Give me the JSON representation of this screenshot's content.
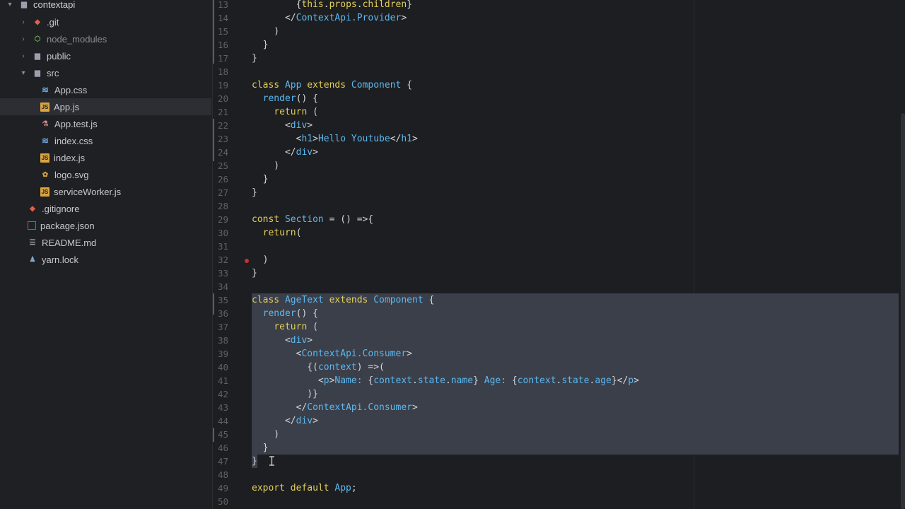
{
  "sidebar": {
    "items": [
      {
        "label": "contextapi",
        "icon": "folder-open-icon",
        "chev": "▾"
      },
      {
        "label": ".git",
        "icon": "git-icon",
        "chev": "›"
      },
      {
        "label": "node_modules",
        "icon": "node-icon",
        "chev": "›"
      },
      {
        "label": "public",
        "icon": "folder-icon",
        "chev": "›"
      },
      {
        "label": "src",
        "icon": "folder-open-icon",
        "chev": "▾"
      },
      {
        "label": "App.css",
        "icon": "css-icon"
      },
      {
        "label": "App.js",
        "icon": "js-icon"
      },
      {
        "label": "App.test.js",
        "icon": "test-icon"
      },
      {
        "label": "index.css",
        "icon": "css-icon"
      },
      {
        "label": "index.js",
        "icon": "js-icon"
      },
      {
        "label": "logo.svg",
        "icon": "svg-icon"
      },
      {
        "label": "serviceWorker.js",
        "icon": "js-icon"
      },
      {
        "label": ".gitignore",
        "icon": "git-icon"
      },
      {
        "label": "package.json",
        "icon": "npm-icon"
      },
      {
        "label": "README.md",
        "icon": "readme-icon"
      },
      {
        "label": "yarn.lock",
        "icon": "yarn-icon"
      }
    ]
  },
  "editor": {
    "lines": [
      {
        "n": "13",
        "segs": [
          [
            "plain",
            "        {"
          ],
          [
            "kw",
            "this"
          ],
          [
            "plain",
            "."
          ],
          [
            "kw",
            "props"
          ],
          [
            "plain",
            "."
          ],
          [
            "kw",
            "children"
          ],
          [
            "plain",
            "}"
          ]
        ]
      },
      {
        "n": "14",
        "segs": [
          [
            "plain",
            "      </"
          ],
          [
            "tagname",
            "ContextApi.Provider"
          ],
          [
            "plain",
            ">"
          ]
        ]
      },
      {
        "n": "15",
        "segs": [
          [
            "plain",
            "    )"
          ]
        ]
      },
      {
        "n": "16",
        "segs": [
          [
            "plain",
            "  }"
          ]
        ]
      },
      {
        "n": "17",
        "segs": [
          [
            "plain",
            "}"
          ]
        ]
      },
      {
        "n": "18",
        "segs": []
      },
      {
        "n": "19",
        "segs": [
          [
            "kw",
            "class "
          ],
          [
            "cls",
            "App "
          ],
          [
            "kw",
            "extends "
          ],
          [
            "cls",
            "Component "
          ],
          [
            "plain",
            "{"
          ]
        ]
      },
      {
        "n": "20",
        "segs": [
          [
            "plain",
            "  "
          ],
          [
            "cls",
            "render"
          ],
          [
            "plain",
            "() {"
          ]
        ]
      },
      {
        "n": "21",
        "segs": [
          [
            "plain",
            "    "
          ],
          [
            "kw",
            "return"
          ],
          [
            "plain",
            " ("
          ]
        ]
      },
      {
        "n": "22",
        "segs": [
          [
            "plain",
            "      <"
          ],
          [
            "tagname",
            "div"
          ],
          [
            "plain",
            ">"
          ]
        ]
      },
      {
        "n": "23",
        "segs": [
          [
            "plain",
            "        <"
          ],
          [
            "tagname",
            "h1"
          ],
          [
            "plain",
            ">"
          ],
          [
            "txt",
            "Hello Youtube"
          ],
          [
            "plain",
            "</"
          ],
          [
            "tagname",
            "h1"
          ],
          [
            "plain",
            ">"
          ]
        ]
      },
      {
        "n": "24",
        "segs": [
          [
            "plain",
            "      </"
          ],
          [
            "tagname",
            "div"
          ],
          [
            "plain",
            ">"
          ]
        ]
      },
      {
        "n": "25",
        "segs": [
          [
            "plain",
            "    )"
          ]
        ]
      },
      {
        "n": "26",
        "segs": [
          [
            "plain",
            "  }"
          ]
        ]
      },
      {
        "n": "27",
        "segs": [
          [
            "plain",
            "}"
          ]
        ]
      },
      {
        "n": "28",
        "segs": []
      },
      {
        "n": "29",
        "segs": [
          [
            "kw",
            "const "
          ],
          [
            "cls",
            "Section "
          ],
          [
            "plain",
            "= () =>{"
          ]
        ]
      },
      {
        "n": "30",
        "segs": [
          [
            "plain",
            "  "
          ],
          [
            "kw",
            "return"
          ],
          [
            "plain",
            "("
          ]
        ]
      },
      {
        "n": "31",
        "segs": []
      },
      {
        "n": "32",
        "segs": [
          [
            "plain",
            "  )"
          ]
        ]
      },
      {
        "n": "33",
        "segs": [
          [
            "plain",
            "}"
          ]
        ]
      },
      {
        "n": "34",
        "segs": []
      },
      {
        "n": "35",
        "segs": [
          [
            "kw",
            "class "
          ],
          [
            "cls",
            "AgeText "
          ],
          [
            "kw",
            "extends "
          ],
          [
            "cls",
            "Component "
          ],
          [
            "plain",
            "{"
          ]
        ]
      },
      {
        "n": "36",
        "segs": [
          [
            "plain",
            "  "
          ],
          [
            "cls",
            "render"
          ],
          [
            "plain",
            "() {"
          ]
        ]
      },
      {
        "n": "37",
        "segs": [
          [
            "plain",
            "    "
          ],
          [
            "kw",
            "return"
          ],
          [
            "plain",
            " ("
          ]
        ]
      },
      {
        "n": "38",
        "segs": [
          [
            "plain",
            "      <"
          ],
          [
            "tagname",
            "div"
          ],
          [
            "plain",
            ">"
          ]
        ]
      },
      {
        "n": "39",
        "segs": [
          [
            "plain",
            "        <"
          ],
          [
            "tagname",
            "ContextApi.Consumer"
          ],
          [
            "plain",
            ">"
          ]
        ]
      },
      {
        "n": "40",
        "segs": [
          [
            "plain",
            "          {("
          ],
          [
            "cls",
            "context"
          ],
          [
            "plain",
            ") =>("
          ]
        ]
      },
      {
        "n": "41",
        "segs": [
          [
            "plain",
            "            <"
          ],
          [
            "tagname",
            "p"
          ],
          [
            "plain",
            ">"
          ],
          [
            "txt",
            "Name: "
          ],
          [
            "plain",
            "{"
          ],
          [
            "cls",
            "context"
          ],
          [
            "plain",
            "."
          ],
          [
            "cls",
            "state"
          ],
          [
            "plain",
            "."
          ],
          [
            "cls",
            "name"
          ],
          [
            "plain",
            "} "
          ],
          [
            "txt",
            "Age: "
          ],
          [
            "plain",
            "{"
          ],
          [
            "cls",
            "context"
          ],
          [
            "plain",
            "."
          ],
          [
            "cls",
            "state"
          ],
          [
            "plain",
            "."
          ],
          [
            "cls",
            "age"
          ],
          [
            "plain",
            "}</"
          ],
          [
            "tagname",
            "p"
          ],
          [
            "plain",
            ">"
          ]
        ]
      },
      {
        "n": "42",
        "segs": [
          [
            "plain",
            "          )}"
          ]
        ]
      },
      {
        "n": "43",
        "segs": [
          [
            "plain",
            "        </"
          ],
          [
            "tagname",
            "ContextApi.Consumer"
          ],
          [
            "plain",
            ">"
          ]
        ]
      },
      {
        "n": "44",
        "segs": [
          [
            "plain",
            "      </"
          ],
          [
            "tagname",
            "div"
          ],
          [
            "plain",
            ">"
          ]
        ]
      },
      {
        "n": "45",
        "segs": [
          [
            "plain",
            "    )"
          ]
        ]
      },
      {
        "n": "46",
        "segs": [
          [
            "plain",
            "  }"
          ]
        ]
      },
      {
        "n": "47",
        "segs": [
          [
            "plain",
            "}"
          ]
        ]
      },
      {
        "n": "48",
        "segs": []
      },
      {
        "n": "49",
        "segs": [
          [
            "kw",
            "export default "
          ],
          [
            "cls",
            "App"
          ],
          [
            "plain",
            ";"
          ]
        ]
      },
      {
        "n": "50",
        "segs": []
      }
    ]
  }
}
